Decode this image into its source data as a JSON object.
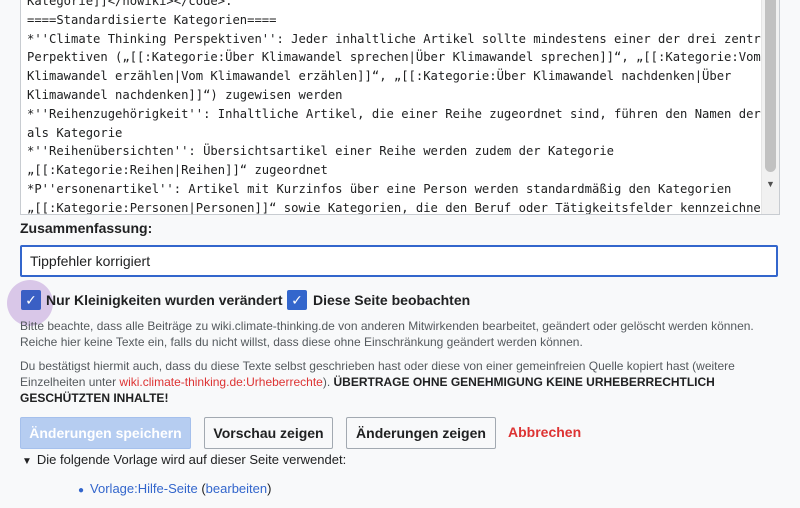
{
  "editor": {
    "lines": [
      "Kategorie]]</nowiki></code>.",
      "====Standardisierte Kategorien====",
      "*''Climate Thinking Perspektiven'': Jeder inhaltliche Artikel sollte mindestens einer der drei zentralen",
      "Perpektiven („[[:Kategorie:Über Klimawandel sprechen|Über Klimawandel sprechen]]“, „[[:Kategorie:Vom",
      "Klimawandel erzählen|Vom Klimawandel erzählen]]“, „[[:Kategorie:Über Klimawandel nachdenken|Über",
      "Klimawandel nachdenken]]“) zugewisen werden",
      "*''Reihenzugehörigkeit'': Inhaltliche Artikel, die einer Reihe zugeordnet sind, führen den Namen der Reihe",
      "als Kategorie",
      "*''Reihenübersichten'': Übersichtsartikel einer Reihe werden zudem der Kategorie",
      "„[[:Kategorie:Reihen|Reihen]]“ zugeordnet",
      "*P''ersonenartikel'': Artikel mit Kurzinfos über eine Person werden standardmäßig den Kategorien",
      "„[[:Kategorie:Personen|Personen]]“ sowie Kategorien, die den Beruf oder Tätigkeitsfelder kennzeichnen"
    ]
  },
  "summary": {
    "label": "Zusammenfassung:",
    "value": "Tippfehler korrigiert"
  },
  "options": {
    "minor_label": "Nur Kleinigkeiten wurden verändert",
    "minor_checked": true,
    "watch_label": "Diese Seite beobachten",
    "watch_checked": true,
    "check_glyph": "✓"
  },
  "notice1": {
    "line1": "Bitte beachte, dass alle Beiträge zu wiki.climate-thinking.de von anderen Mitwirkenden bearbeitet, geändert oder gelöscht werden können.",
    "line2": "Reiche hier keine Texte ein, falls du nicht willst, dass diese ohne Einschränkung geändert werden können."
  },
  "notice2": {
    "text_a": "Du bestätigst hiermit auch, dass du diese Texte selbst geschrieben hast oder diese von einer gemeinfreien Quelle kopiert hast (weitere",
    "text_b": "Einzelheiten unter ",
    "link": "wiki.climate-thinking.de:Urheberrechte",
    "text_c": "). ",
    "bold_a": "ÜBERTRAGE OHNE GENEHMIGUNG KEINE URHEBERRECHTLICH",
    "bold_b": "GESCHÜTZTEN INHALTE!"
  },
  "buttons": {
    "save": "Änderungen speichern",
    "preview": "Vorschau zeigen",
    "changes": "Änderungen zeigen",
    "cancel": "Abbrechen"
  },
  "templates": {
    "toggle": "Die folgende Vorlage wird auf dieser Seite verwendet:",
    "item_link": "Vorlage:Hilfe-Seite",
    "edit_open": " (",
    "edit_link": "bearbeiten",
    "edit_close": ")"
  },
  "colors": {
    "progressive": "#3366cc",
    "destructive": "#d33333",
    "focus_halo": "#d9c7e8"
  }
}
